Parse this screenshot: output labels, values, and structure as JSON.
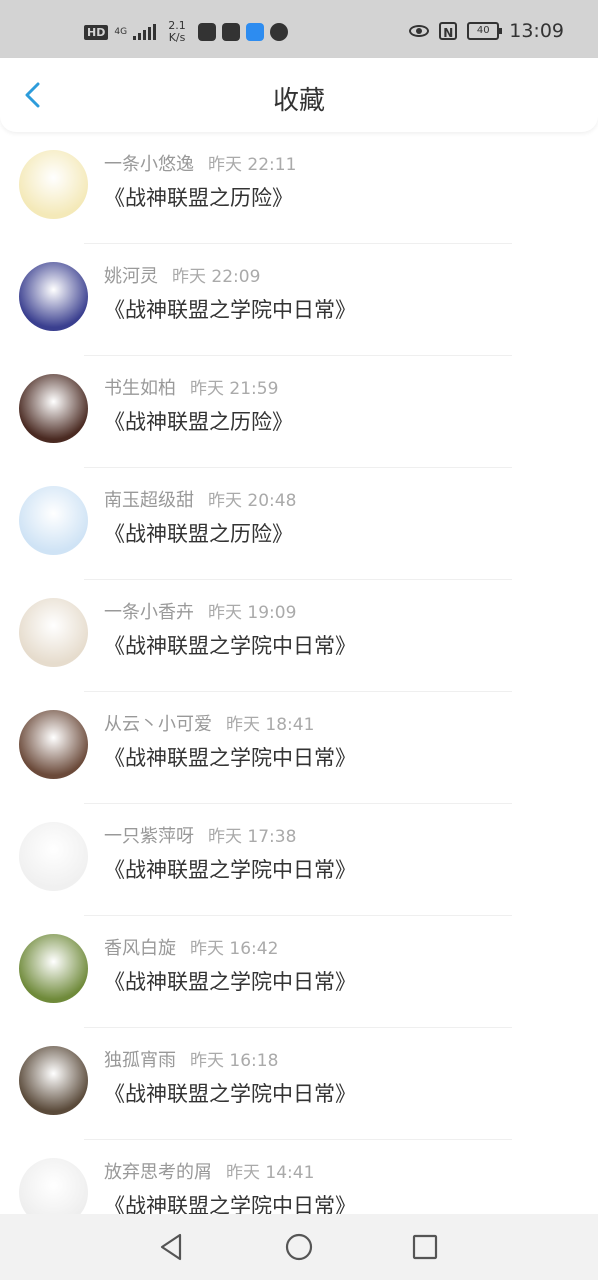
{
  "status_bar": {
    "hd": "HD",
    "network": "4G",
    "speed_value": "2.1",
    "speed_unit": "K/s",
    "battery": "40",
    "nfc": "N",
    "time": "13:09"
  },
  "header": {
    "title": "收藏"
  },
  "favorites": [
    {
      "user": "一条小悠逸",
      "time": "昨天 22:11",
      "book": "《战神联盟之历险》",
      "avatar_color": "#f4e9b8"
    },
    {
      "user": "姚河灵",
      "time": "昨天 22:09",
      "book": "《战神联盟之学院中日常》",
      "avatar_color": "#3a3f8f"
    },
    {
      "user": "书生如柏",
      "time": "昨天 21:59",
      "book": "《战神联盟之历险》",
      "avatar_color": "#4a2a22"
    },
    {
      "user": "南玉超级甜",
      "time": "昨天 20:48",
      "book": "《战神联盟之历险》",
      "avatar_color": "#cfe3f5"
    },
    {
      "user": "一条小香卉",
      "time": "昨天 19:09",
      "book": "《战神联盟之学院中日常》",
      "avatar_color": "#e6dccd"
    },
    {
      "user": "从云丶小可爱",
      "time": "昨天 18:41",
      "book": "《战神联盟之学院中日常》",
      "avatar_color": "#6b4a3a"
    },
    {
      "user": "一只紫萍呀",
      "time": "昨天 17:38",
      "book": "《战神联盟之学院中日常》",
      "avatar_color": "#f0f0f0"
    },
    {
      "user": "香风白旋",
      "time": "昨天 16:42",
      "book": "《战神联盟之学院中日常》",
      "avatar_color": "#6f8a3a"
    },
    {
      "user": "独孤宵雨",
      "time": "昨天 16:18",
      "book": "《战神联盟之学院中日常》",
      "avatar_color": "#5a4a3a"
    },
    {
      "user": "放弃思考的屑",
      "time": "昨天 14:41",
      "book": "《战神联盟之学院中日常》",
      "avatar_color": "#eeeeee"
    }
  ],
  "colors": {
    "accent": "#2d9cdb",
    "status_bar_bg": "#d3d3d3",
    "nav_bar_bg": "#f2f2f2"
  }
}
